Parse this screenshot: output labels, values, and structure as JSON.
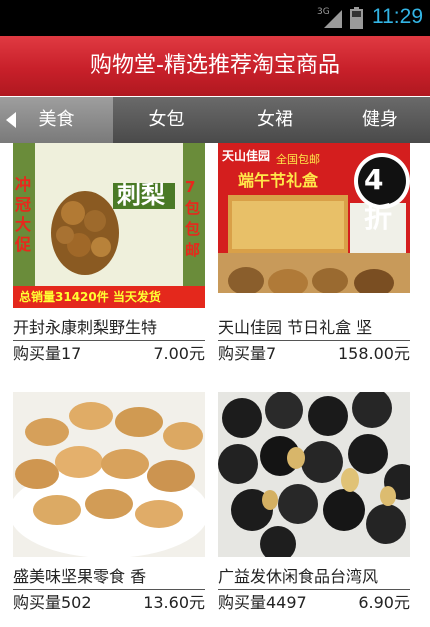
{
  "status_bar": {
    "network": "3G",
    "time": "11:29"
  },
  "app": {
    "title": "购物堂-精选推荐淘宝商品"
  },
  "tabs": [
    {
      "label": "美食",
      "active": true
    },
    {
      "label": "女包",
      "active": false
    },
    {
      "label": "女裙",
      "active": false
    },
    {
      "label": "健身",
      "active": false
    }
  ],
  "products": [
    {
      "name": "开封永康刺梨野生特",
      "sales": "购买量17",
      "price": "7.00元",
      "image_text": {
        "brand": "刺梨",
        "promo": "冲冠大促",
        "ship": "7包包邮",
        "banner": "总销量31420件 当天发货"
      }
    },
    {
      "name": "天山佳园 节日礼盒 坚",
      "sales": "购买量7",
      "price": "158.00元",
      "image_text": {
        "brand": "天山佳园",
        "tag": "全国包邮",
        "headline": "端午节礼盒",
        "discount": "4折"
      }
    },
    {
      "name": "盛美味坚果零食 香",
      "sales": "购买量502",
      "price": "13.60元"
    },
    {
      "name": "广益发休闲食品台湾风",
      "sales": "购买量4497",
      "price": "6.90元"
    }
  ]
}
